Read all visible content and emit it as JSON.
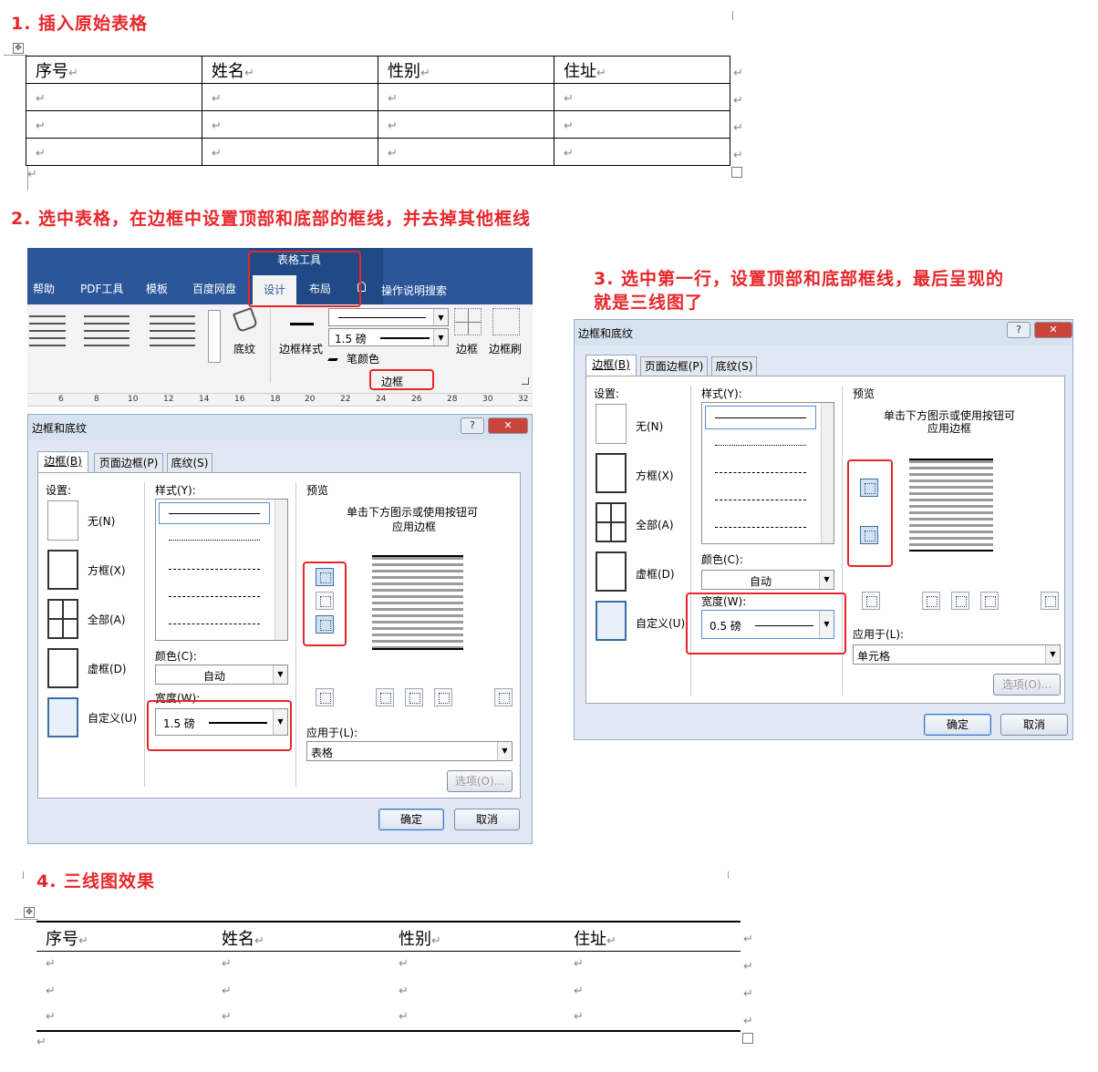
{
  "steps": {
    "s1": "1. 插入原始表格",
    "s2": "2. 选中表格，在边框中设置顶部和底部的框线，并去掉其他框线",
    "s3_line1": "3. 选中第一行，设置顶部和底部框线，最后呈现的",
    "s3_line2": "就是三线图了",
    "s4": "4. 三线图效果"
  },
  "table": {
    "headers": [
      "序号",
      "姓名",
      "性别",
      "住址"
    ],
    "para_mark": "↵",
    "move_icon": "✥"
  },
  "ribbon": {
    "context_title": "表格工具",
    "tabs": [
      "帮助",
      "PDF工具",
      "模板",
      "百度网盘",
      "设计",
      "布局"
    ],
    "search_label": "操作说明搜索",
    "shading_label": "底纹",
    "border_style_label": "边框样式",
    "width_value": "1.5 磅",
    "pen_color_label": "笔颜色",
    "borders_label": "边框",
    "border_painter_label": "边框刷",
    "group_label": "边框",
    "ruler_ticks": [
      "6",
      "8",
      "10",
      "12",
      "14",
      "16",
      "18",
      "20",
      "22",
      "24",
      "26",
      "28",
      "30",
      "32"
    ]
  },
  "dialog": {
    "title": "边框和底纹",
    "help": "?",
    "close": "✕",
    "tabs": [
      "边框(B)",
      "页面边框(P)",
      "底纹(S)"
    ],
    "setting_label": "设置:",
    "settings": [
      "无(N)",
      "方框(X)",
      "全部(A)",
      "虚框(D)",
      "自定义(U)"
    ],
    "style_label": "样式(Y):",
    "color_label": "颜色(C):",
    "color_value": "自动",
    "width_label": "宽度(W):",
    "preview_label": "预览",
    "preview_hint_1": "单击下方图示或使用按钮可",
    "preview_hint_2": "应用边框",
    "apply_label": "应用于(L):",
    "options": "选项(O)...",
    "ok": "确定",
    "cancel": "取消"
  },
  "dialog_a": {
    "width_value": "1.5 磅",
    "apply_value": "表格"
  },
  "dialog_b": {
    "width_value": "0.5 磅",
    "apply_value": "单元格"
  },
  "colors": {
    "accent_red": "#e8262a",
    "word_blue": "#2b579a",
    "dialog_bg": "#dfe8f3"
  }
}
